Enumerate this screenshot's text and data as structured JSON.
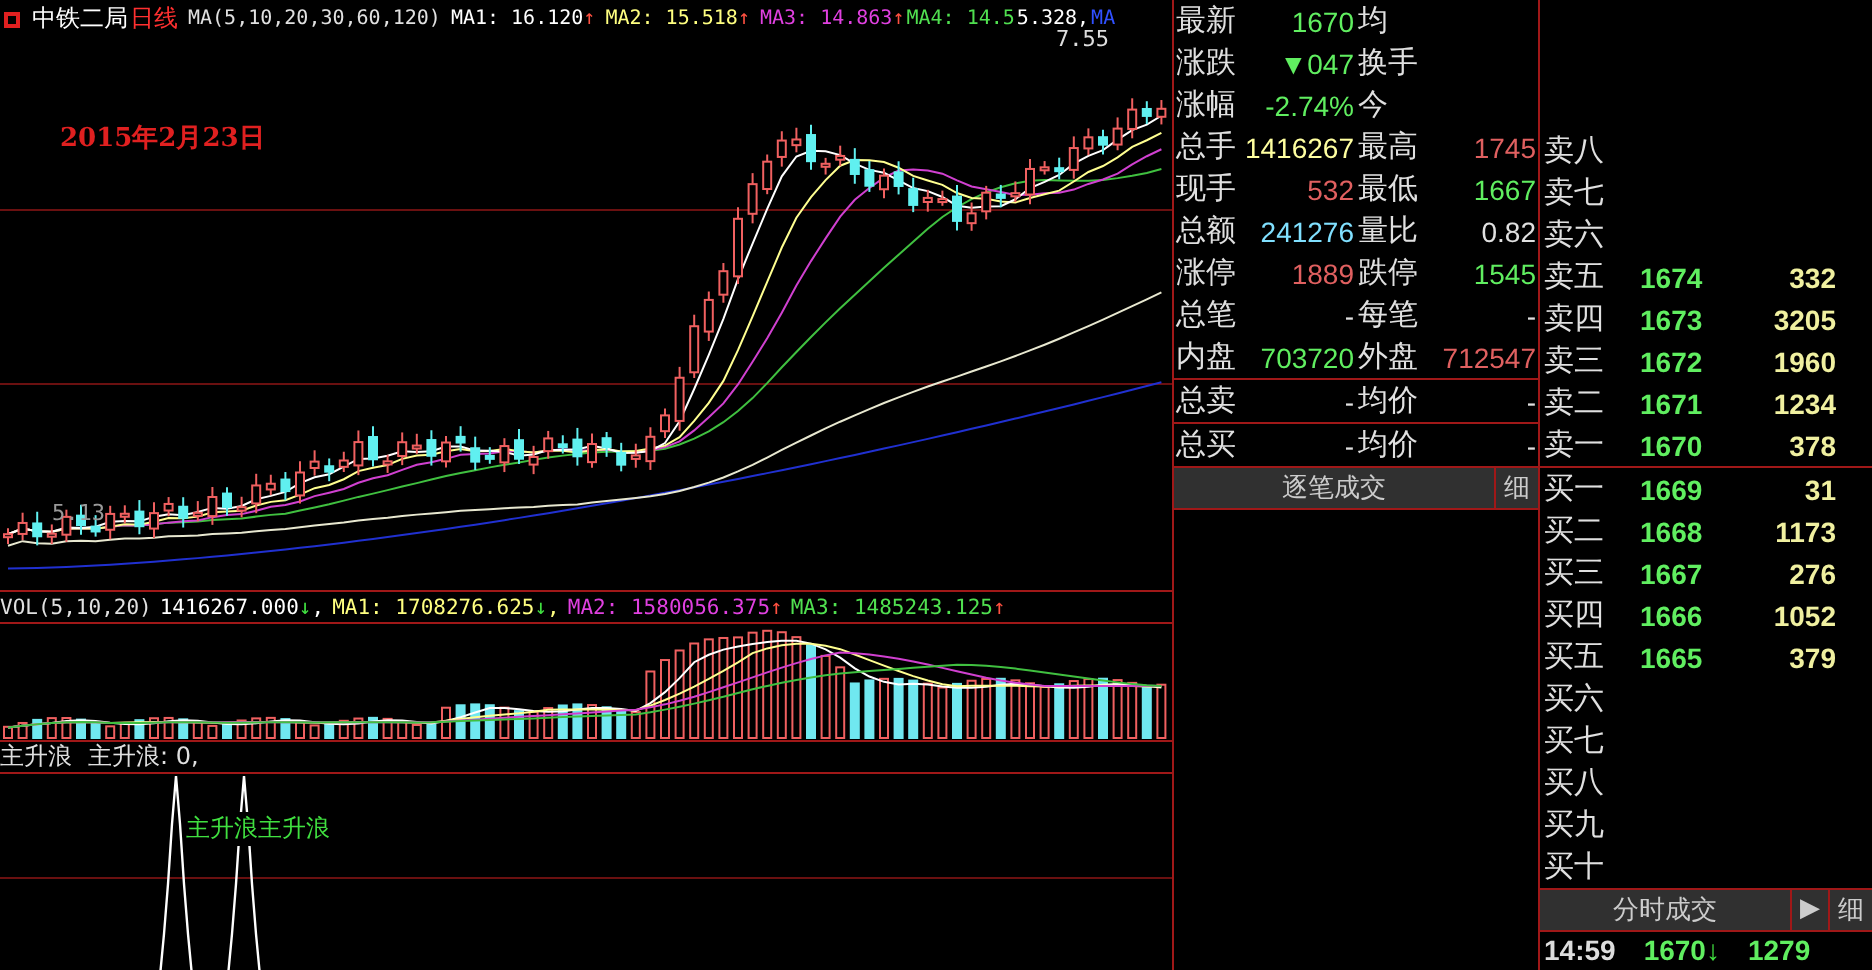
{
  "chart_header": {
    "stock_name": "中铁二局",
    "period": "日线",
    "ma_params": "MA(5,10,20,30,60,120)",
    "readings": [
      {
        "text": "MA1: 16.120",
        "arrow": {
          "text": "↑",
          "color": "#ff5040"
        },
        "color": "#ffffff"
      },
      {
        "text": "MA2: 15.518",
        "arrow": {
          "text": "↑",
          "color": "#ff5040"
        },
        "color": "#ffff80"
      },
      {
        "text": "MA3: 14.863",
        "arrow": {
          "text": "↑",
          "color": "#ff5040"
        },
        "color": "#e040e0"
      },
      {
        "text": "MA4: 14.5",
        "color": "#50e050"
      },
      {
        "text": "5.328,",
        "color": "#ffffff"
      },
      {
        "text": "MA",
        "color": "#3050ff"
      }
    ]
  },
  "main_chart": {
    "date_note": "2015年2月23日",
    "price_marks": [
      "7.55",
      "5.13"
    ]
  },
  "volume": {
    "title": "VOL(5,10,20)",
    "readings": [
      {
        "text": "1416267.000",
        "arrow": {
          "text": "↓",
          "color": "#40e040"
        },
        "separator": ",",
        "color": "#ffffff"
      },
      {
        "text": "MA1: 1708276.625",
        "arrow": {
          "text": "↓",
          "color": "#40e040"
        },
        "separator": ",",
        "color": "#ffff80"
      },
      {
        "text": "MA2: 1580056.375",
        "arrow": {
          "text": "↑",
          "color": "#ff5040"
        },
        "color": "#e040e0"
      },
      {
        "text": "MA3: 1485243.125",
        "arrow": {
          "text": "↑",
          "color": "#ff5040"
        },
        "color": "#50e050"
      }
    ]
  },
  "indicator": {
    "title": "主升浪",
    "reading": "主升浪: 0,",
    "signal_label": "主升浪主升浪"
  },
  "quote": {
    "rows": [
      {
        "cells": [
          {
            "label": "最新",
            "value": "1670",
            "color": "#60ee60"
          },
          {
            "label": "均"
          }
        ]
      },
      {
        "cells": [
          {
            "label": "涨跌",
            "value": "▼047",
            "color": "#60ee60"
          },
          {
            "label": "换手"
          }
        ]
      },
      {
        "cells": [
          {
            "label": "涨幅",
            "value": "-2.74%",
            "color": "#60ee60"
          },
          {
            "label": "今"
          }
        ]
      },
      {
        "cells": [
          {
            "label": "总手",
            "value": "1416267",
            "color": "#ffffa0"
          },
          {
            "label": "最高",
            "value": "1745",
            "color": "#e06060"
          }
        ]
      },
      {
        "cells": [
          {
            "label": "现手",
            "value": "532",
            "color": "#e06060"
          },
          {
            "label": "最低",
            "value": "1667",
            "color": "#60ee60"
          }
        ]
      },
      {
        "cells": [
          {
            "label": "总额",
            "value": "241276",
            "color": "#80e0ff"
          },
          {
            "label": "量比",
            "value": "0.82",
            "color": "#e0e0e0"
          }
        ]
      },
      {
        "cells": [
          {
            "label": "涨停",
            "value": "1889",
            "color": "#e06060"
          },
          {
            "label": "跌停",
            "value": "1545",
            "color": "#60ee60"
          }
        ]
      },
      {
        "cells": [
          {
            "label": "总笔",
            "value": "-",
            "color": "#e0e0e0"
          },
          {
            "label": "每笔",
            "value": "-",
            "color": "#e0e0e0"
          }
        ]
      },
      {
        "cells": [
          {
            "label": "内盘",
            "value": "703720",
            "color": "#60ee60"
          },
          {
            "label": "外盘",
            "value": "712547",
            "color": "#e06060"
          }
        ]
      }
    ],
    "summary_rows": [
      {
        "cells": [
          {
            "label": "总卖",
            "value": "-",
            "color": "#e0e0e0"
          },
          {
            "label": "均价",
            "value": "-",
            "color": "#e0e0e0"
          }
        ]
      },
      {
        "cells": [
          {
            "label": "总买",
            "value": "-",
            "color": "#e0e0e0"
          },
          {
            "label": "均价",
            "value": "-",
            "color": "#e0e0e0"
          }
        ]
      }
    ]
  },
  "tick_panel": {
    "title": "逐笔成交",
    "detail_button": "细"
  },
  "order_book": {
    "asks": [
      {
        "label": "卖八"
      },
      {
        "label": "卖七"
      },
      {
        "label": "卖六"
      },
      {
        "label": "卖五",
        "price": "1674",
        "volume": "332"
      },
      {
        "label": "卖四",
        "price": "1673",
        "volume": "3205"
      },
      {
        "label": "卖三",
        "price": "1672",
        "volume": "1960"
      },
      {
        "label": "卖二",
        "price": "1671",
        "volume": "1234"
      },
      {
        "label": "卖一",
        "price": "1670",
        "volume": "378"
      }
    ],
    "bids": [
      {
        "label": "买一",
        "price": "1669",
        "volume": "31"
      },
      {
        "label": "买二",
        "price": "1668",
        "volume": "1173"
      },
      {
        "label": "买三",
        "price": "1667",
        "volume": "276"
      },
      {
        "label": "买四",
        "price": "1666",
        "volume": "1052"
      },
      {
        "label": "买五",
        "price": "1665",
        "volume": "379"
      },
      {
        "label": "买六"
      },
      {
        "label": "买七"
      },
      {
        "label": "买八"
      },
      {
        "label": "买九"
      },
      {
        "label": "买十"
      }
    ]
  },
  "minute_panel": {
    "title": "分时成交",
    "play_button": "▶",
    "detail_button": "细",
    "trades": [
      {
        "time": "14:59",
        "price": "1670",
        "arrow": {
          "text": "↓",
          "color": "#40e040"
        },
        "volume": "1279"
      }
    ]
  }
}
